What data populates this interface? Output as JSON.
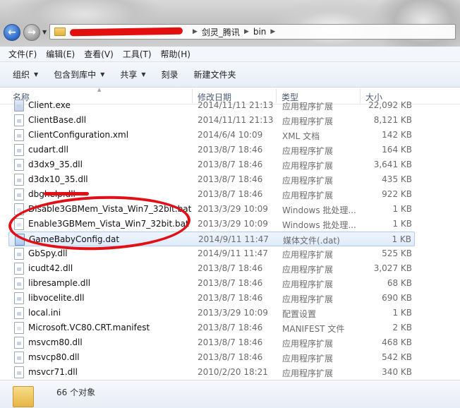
{
  "address": {
    "crumbs": [
      "剑灵_腾讯",
      "bin"
    ]
  },
  "menu": [
    "文件(F)",
    "编辑(E)",
    "查看(V)",
    "工具(T)",
    "帮助(H)"
  ],
  "commands": [
    {
      "label": "组织",
      "dropdown": true
    },
    {
      "label": "包含到库中",
      "dropdown": true
    },
    {
      "label": "共享",
      "dropdown": true
    },
    {
      "label": "刻录",
      "dropdown": false
    },
    {
      "label": "新建文件夹",
      "dropdown": false
    }
  ],
  "columns": {
    "name": "名称",
    "date": "修改日期",
    "type": "类型",
    "size": "大小"
  },
  "files": [
    {
      "name": "Client.exe",
      "date": "2014/11/11 21:13",
      "type": "应用程序扩展",
      "size": "22,092 KB",
      "icon": "exe"
    },
    {
      "name": "ClientBase.dll",
      "date": "2014/11/11 21:13",
      "type": "应用程序扩展",
      "size": "8,121 KB",
      "icon": "dll"
    },
    {
      "name": "ClientConfiguration.xml",
      "date": "2014/6/4 10:09",
      "type": "XML 文档",
      "size": "142 KB",
      "icon": "xml"
    },
    {
      "name": "cudart.dll",
      "date": "2013/8/7 18:46",
      "type": "应用程序扩展",
      "size": "164 KB",
      "icon": "dll"
    },
    {
      "name": "d3dx9_35.dll",
      "date": "2013/8/7 18:46",
      "type": "应用程序扩展",
      "size": "3,641 KB",
      "icon": "dll"
    },
    {
      "name": "d3dx10_35.dll",
      "date": "2013/8/7 18:46",
      "type": "应用程序扩展",
      "size": "435 KB",
      "icon": "dll"
    },
    {
      "name": "dbghelp.dll",
      "date": "2013/8/7 18:46",
      "type": "应用程序扩展",
      "size": "922 KB",
      "icon": "dll"
    },
    {
      "name": "Disable3GBMem_Vista_Win7_32bit.bat",
      "date": "2013/3/29 10:09",
      "type": "Windows 批处理...",
      "size": "1 KB",
      "icon": "bat"
    },
    {
      "name": "Enable3GBMem_Vista_Win7_32bit.bat",
      "date": "2013/3/29 10:09",
      "type": "Windows 批处理...",
      "size": "1 KB",
      "icon": "bat"
    },
    {
      "name": "GameBabyConfig.dat",
      "date": "2014/9/11 11:47",
      "type": "媒体文件(.dat)",
      "size": "1 KB",
      "icon": "dat",
      "selected": true
    },
    {
      "name": "GbSpy.dll",
      "date": "2014/9/11 11:47",
      "type": "应用程序扩展",
      "size": "525 KB",
      "icon": "dll"
    },
    {
      "name": "icudt42.dll",
      "date": "2013/8/7 18:46",
      "type": "应用程序扩展",
      "size": "3,027 KB",
      "icon": "dll"
    },
    {
      "name": "libresample.dll",
      "date": "2013/8/7 18:46",
      "type": "应用程序扩展",
      "size": "68 KB",
      "icon": "dll"
    },
    {
      "name": "libvocelite.dll",
      "date": "2013/8/7 18:46",
      "type": "应用程序扩展",
      "size": "690 KB",
      "icon": "dll"
    },
    {
      "name": "local.ini",
      "date": "2013/3/29 10:09",
      "type": "配置设置",
      "size": "1 KB",
      "icon": "ini"
    },
    {
      "name": "Microsoft.VC80.CRT.manifest",
      "date": "2013/8/7 18:46",
      "type": "MANIFEST 文件",
      "size": "2 KB",
      "icon": "manifest"
    },
    {
      "name": "msvcm80.dll",
      "date": "2013/8/7 18:46",
      "type": "应用程序扩展",
      "size": "468 KB",
      "icon": "dll"
    },
    {
      "name": "msvcp80.dll",
      "date": "2013/8/7 18:46",
      "type": "应用程序扩展",
      "size": "542 KB",
      "icon": "dll"
    },
    {
      "name": "msvcr71.dll",
      "date": "2010/2/20 18:21",
      "type": "应用程序扩展",
      "size": "340 KB",
      "icon": "dll"
    }
  ],
  "status": {
    "count": "66 个对象"
  }
}
